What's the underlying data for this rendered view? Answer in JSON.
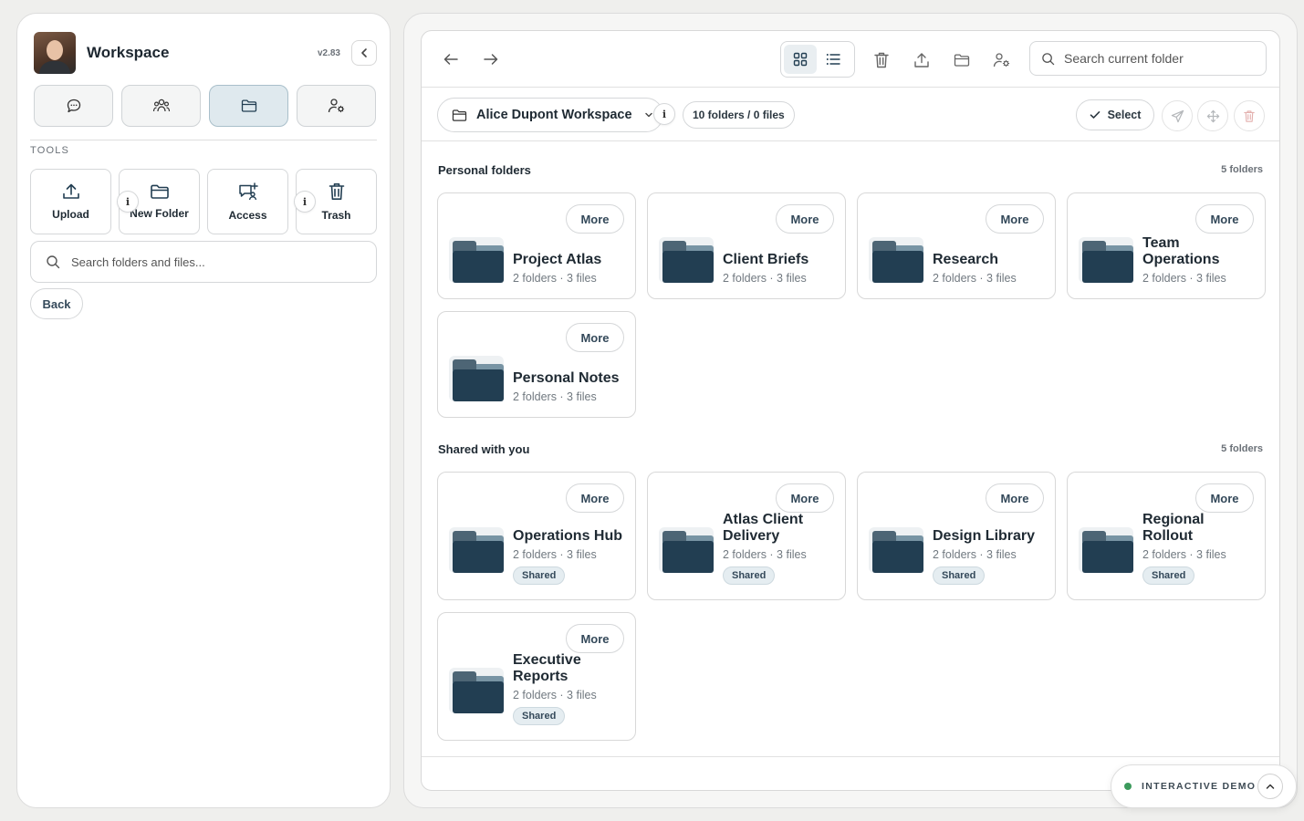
{
  "sidebar": {
    "workspace_title": "Workspace",
    "version": "v2.83",
    "nav": [
      {
        "icon": "chat-icon",
        "active": false
      },
      {
        "icon": "team-icon",
        "active": false
      },
      {
        "icon": "folder-icon",
        "active": true
      },
      {
        "icon": "user-settings-icon",
        "active": false
      }
    ],
    "tools_label": "TOOLS",
    "tools": [
      {
        "label": "Upload",
        "icon": "upload-icon",
        "has_info": true
      },
      {
        "label": "New Folder",
        "icon": "folder-icon",
        "has_info": false
      },
      {
        "label": "Access",
        "icon": "access-icon",
        "has_info": true
      },
      {
        "label": "Trash",
        "icon": "trash-icon",
        "has_info": false
      }
    ],
    "info_glyph": "i",
    "search_placeholder": "Search folders and files...",
    "back_label": "Back"
  },
  "toolbar": {
    "search_placeholder": "Search current folder",
    "view_mode": "grid"
  },
  "subbar": {
    "workspace_name": "Alice Dupont Workspace",
    "info_glyph": "i",
    "count_label": "10 folders / 0 files",
    "select_label": "Select"
  },
  "sections": {
    "personal": {
      "title": "Personal folders",
      "count": "5 folders",
      "more_label": "More",
      "folders": [
        {
          "name": "Project Atlas",
          "meta": "2 folders · 3 files"
        },
        {
          "name": "Client Briefs",
          "meta": "2 folders · 3 files"
        },
        {
          "name": "Research",
          "meta": "2 folders · 3 files"
        },
        {
          "name": "Team Operations",
          "meta": "2 folders · 3 files"
        },
        {
          "name": "Personal Notes",
          "meta": "2 folders · 3 files"
        }
      ]
    },
    "shared": {
      "title": "Shared with you",
      "count": "5 folders",
      "more_label": "More",
      "badge": "Shared",
      "folders": [
        {
          "name": "Operations Hub",
          "meta": "2 folders · 3 files"
        },
        {
          "name": "Atlas Client Delivery",
          "meta": "2 folders · 3 files"
        },
        {
          "name": "Design Library",
          "meta": "2 folders · 3 files"
        },
        {
          "name": "Regional Rollout",
          "meta": "2 folders · 3 files"
        },
        {
          "name": "Executive Reports",
          "meta": "2 folders · 3 files"
        }
      ]
    }
  },
  "demo": {
    "label": "INTERACTIVE DEMO",
    "status_color": "#3c9a5c"
  },
  "colors": {
    "accent": "#223e52",
    "active_nav_bg": "#dfe9ee",
    "page_bg": "#efefed"
  }
}
